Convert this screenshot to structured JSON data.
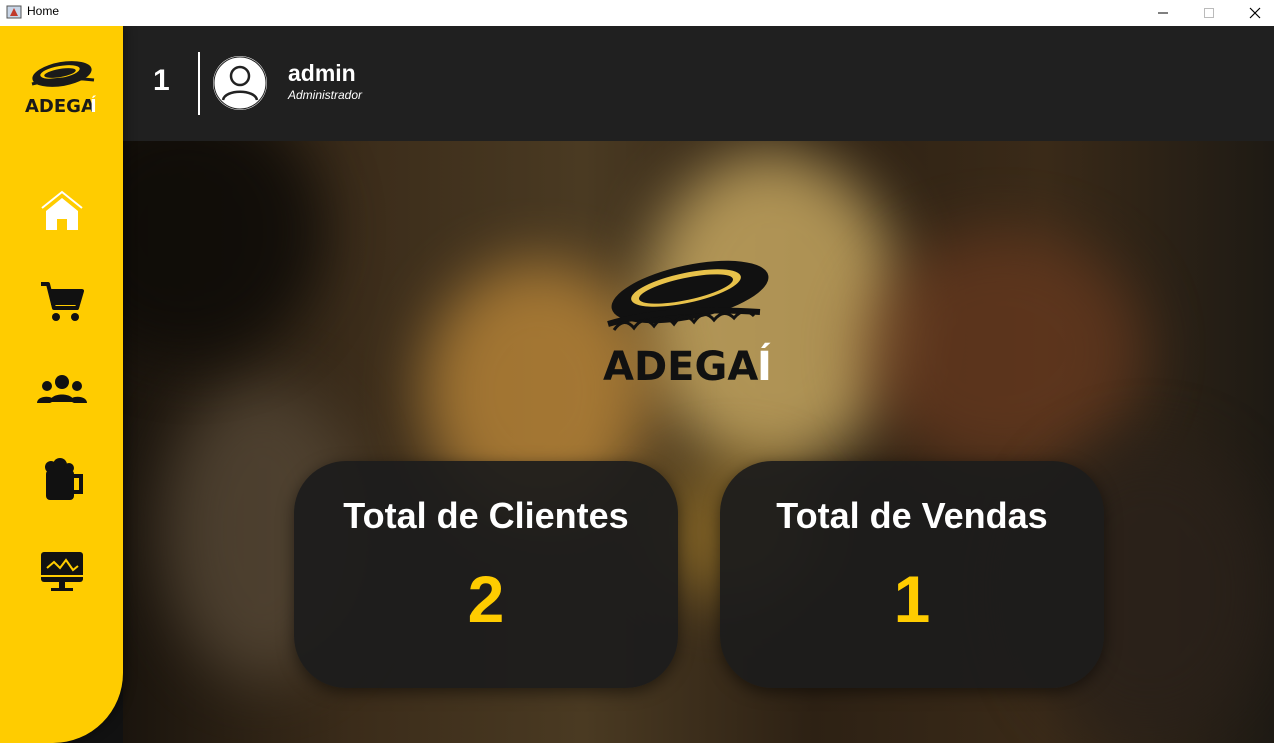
{
  "window": {
    "title": "Home"
  },
  "header": {
    "number": "1",
    "user_name": "admin",
    "user_role": "Administrador"
  },
  "brand": {
    "name": "ADEGA",
    "accent": "Í"
  },
  "sidebar": {
    "items": [
      {
        "icon": "home-icon"
      },
      {
        "icon": "cart-icon"
      },
      {
        "icon": "users-icon"
      },
      {
        "icon": "beer-mug-icon"
      },
      {
        "icon": "monitor-chart-icon"
      }
    ]
  },
  "cards": {
    "clients": {
      "title": "Total de Clientes",
      "value": "2"
    },
    "sales": {
      "title": "Total de Vendas",
      "value": "1"
    }
  },
  "colors": {
    "accent": "#FFCC00",
    "topbar": "#202020",
    "card": "#1c1c1c",
    "text": "#ffffff"
  }
}
